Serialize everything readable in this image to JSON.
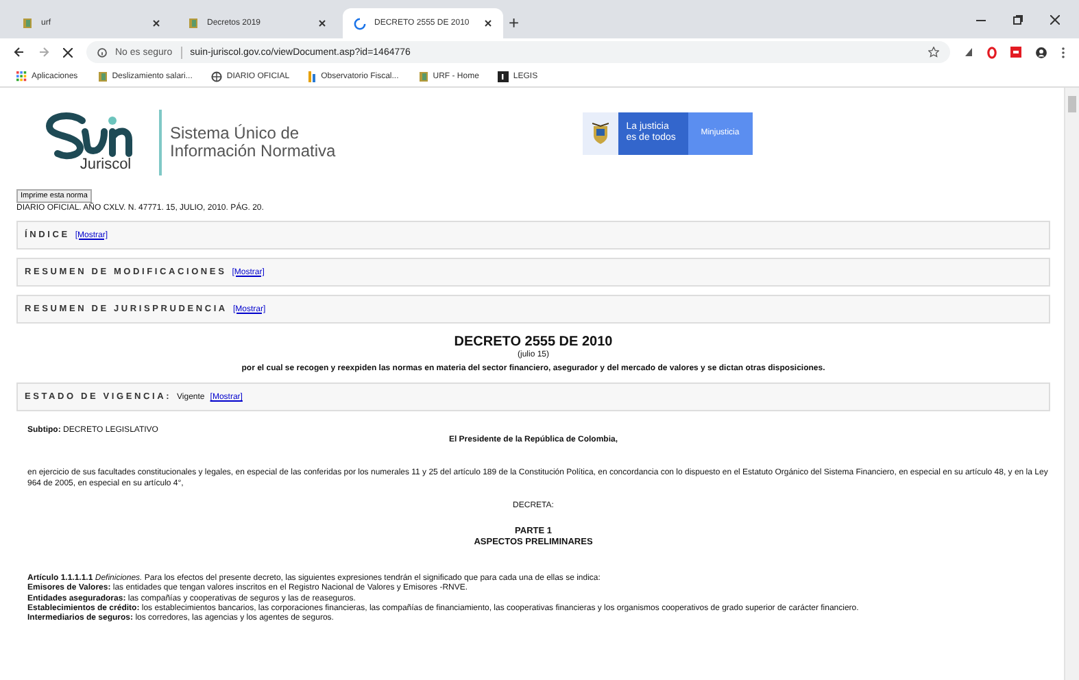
{
  "browser": {
    "tabs": [
      {
        "title": "urf",
        "selected": false,
        "loading": false
      },
      {
        "title": "Decretos 2019",
        "selected": false,
        "loading": false
      },
      {
        "title": "DECRETO 2555 DE 2010",
        "selected": true,
        "loading": true
      }
    ],
    "new_tab": "+",
    "address": {
      "security": "No es seguro",
      "url": "suin-juriscol.gov.co/viewDocument.asp?id=1464776"
    },
    "bookmarks": [
      {
        "label": "Aplicaciones",
        "kind": "apps"
      },
      {
        "label": "Deslizamiento salari...",
        "kind": "doc"
      },
      {
        "label": "DIARIO OFICIAL",
        "kind": "globe"
      },
      {
        "label": "Observatorio Fiscal...",
        "kind": "bars"
      },
      {
        "label": "URF - Home",
        "kind": "doc"
      },
      {
        "label": "LEGIS",
        "kind": "square"
      }
    ]
  },
  "page": {
    "logo": {
      "word": "Juriscol",
      "tagline": [
        "Sistema Único de",
        "Información Normativa"
      ]
    },
    "gov_banner": {
      "slogan": [
        "La justicia",
        "es de todos"
      ],
      "ministry": "Minjusticia"
    },
    "print_button": "Imprime esta norma",
    "source": "DIARIO OFICIAL. AÑO CXLV. N. 47771. 15, JULIO, 2010. PÁG. 20.",
    "sections": [
      {
        "title": "ÍNDICE",
        "link": "[Mostrar]"
      },
      {
        "title": "RESUMEN DE MODIFICACIONES",
        "link": "[Mostrar]"
      },
      {
        "title": "RESUMEN DE JURISPRUDENCIA",
        "link": "[Mostrar]"
      }
    ],
    "decree": {
      "title": "DECRETO 2555 DE 2010",
      "date": "(julio 15)",
      "summary": "por el cual se recogen y reexpiden las normas en materia del sector financiero, asegurador y del mercado de valores y se dictan otras disposiciones."
    },
    "vigencia": {
      "title": "ESTADO DE VIGENCIA:",
      "value": "Vigente",
      "link": "[Mostrar]"
    },
    "subtipo": "**Subtipo:** DECRETO LEGISLATIVO",
    "president": "El Presidente de la República de Colombia,",
    "preamble": "en ejercicio de sus facultades constitucionales y legales, en especial de las conferidas por los numerales 11 y 25 del artículo 189 de la Constitución Política, en concordancia con lo dispuesto en el Estatuto Orgánico del Sistema Financiero, en especial en su artículo 48, y en la Ley 964 de 2005, en especial en su artículo 4°,",
    "decreta": "DECRETA:",
    "part": {
      "number": "PARTE 1",
      "title": "ASPECTOS PRELIMINARES"
    },
    "articles": [
      "**Artículo 1.1.1.1.1** *Definiciones.* Para los efectos del presente decreto, las siguientes expresiones tendrán el significado que para cada una de ellas se indica:",
      "**Emisores de Valores:** las entidades que tengan valores inscritos en el Registro Nacional de Valores y Emisores -RNVE.",
      "**Entidades aseguradoras:** las compañías y cooperativas de seguros y las de reaseguros.",
      "**Establecimientos de crédito:** los establecimientos bancarios, las corporaciones financieras, las compañías de financiamiento, las cooperativas financieras y los organismos cooperativos de grado superior de carácter financiero.",
      "**Intermediarios de seguros:** los corredores, las agencias y los agentes de seguros."
    ]
  }
}
